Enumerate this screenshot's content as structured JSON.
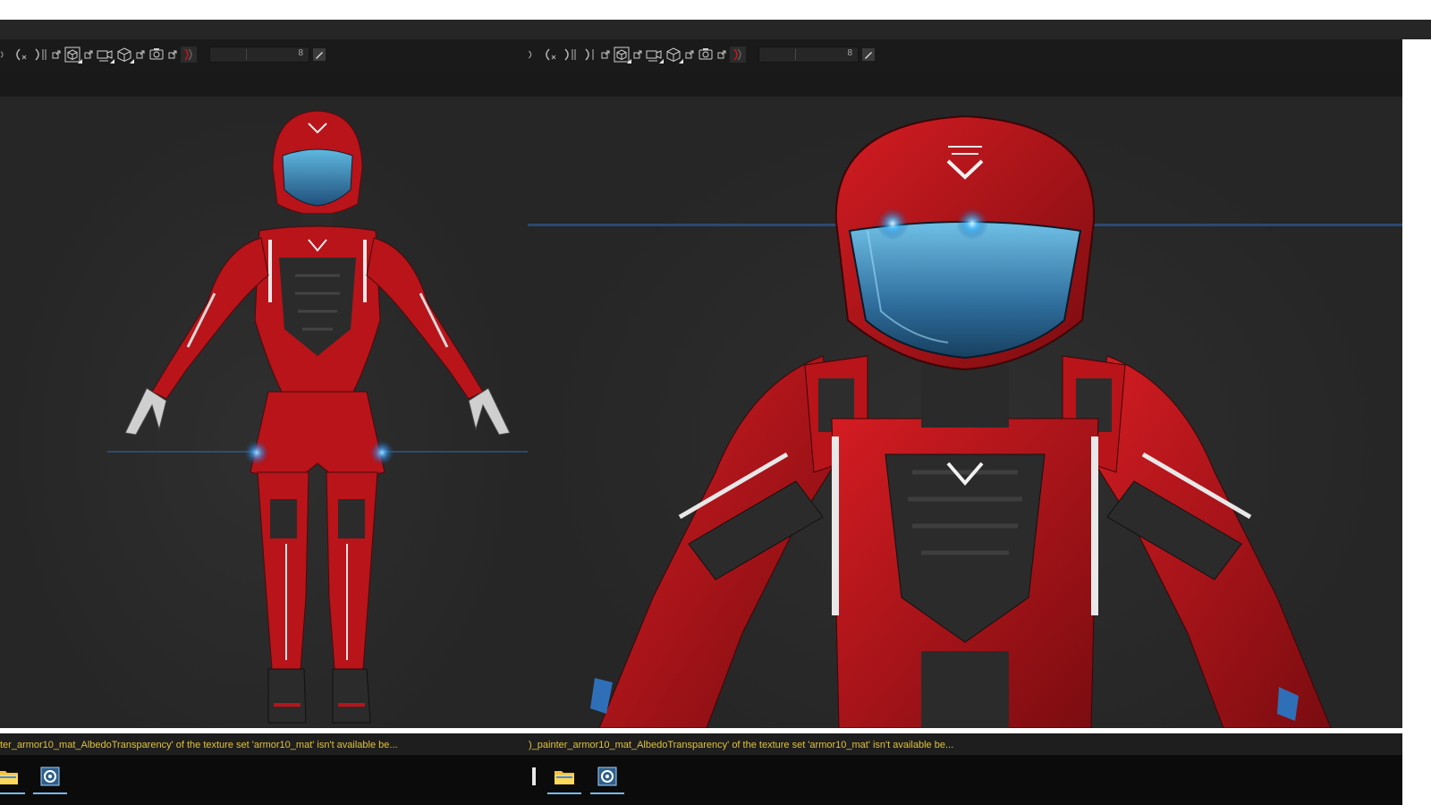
{
  "panels": [
    {
      "id": "left",
      "slider_value": "8",
      "status_message": "ter_armor10_mat_AlbedoTransparency' of the texture set 'armor10_mat' isn't available be..."
    },
    {
      "id": "right",
      "slider_value": "8",
      "status_message": ")_painter_armor10_mat_AlbedoTransparency' of the texture set 'armor10_mat' isn't available be..."
    }
  ],
  "toolbar_icons": [
    "environment-icon",
    "environment-x-icon",
    "environment-flip-icon",
    "external-icon",
    "perspective-cube-icon",
    "camera-icon",
    "ortho-cube-icon",
    "screenshot-camera-icon",
    "light-icon",
    "brush-size-icon"
  ],
  "viewport": {
    "left_view": "full-body-armor-model",
    "right_view": "close-up-armor-model"
  },
  "colors": {
    "armor_red": "#c0161c",
    "armor_dark": "#2b2b2b",
    "visor_blue": "#3a88b6",
    "glow_blue": "#5ac8ff",
    "status_text": "#e0c23a",
    "viewport_bg": "#2a2a2a"
  },
  "taskbar": {
    "icons": [
      "file-explorer-icon",
      "painter-app-icon"
    ]
  }
}
